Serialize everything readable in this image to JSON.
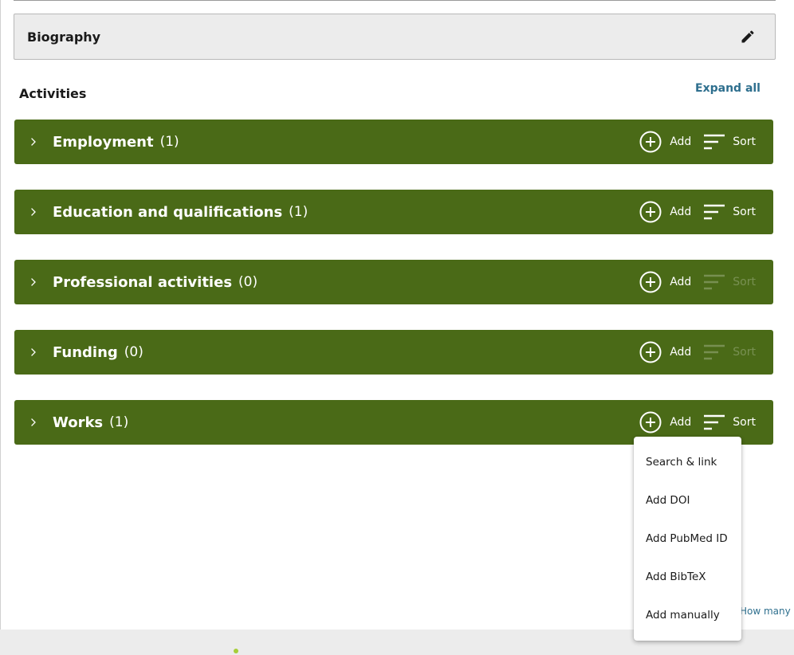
{
  "biography": {
    "title": "Biography",
    "edit_icon": "pencil-icon"
  },
  "activities": {
    "title": "Activities",
    "expand_all": "Expand all"
  },
  "sections": [
    {
      "name": "Employment",
      "count": "(1)",
      "add_label": "Add",
      "sort_label": "Sort",
      "sort_enabled": true
    },
    {
      "name": "Education and qualifications",
      "count": "(1)",
      "add_label": "Add",
      "sort_label": "Sort",
      "sort_enabled": true
    },
    {
      "name": "Professional activities",
      "count": "(0)",
      "add_label": "Add",
      "sort_label": "Sort",
      "sort_enabled": false
    },
    {
      "name": "Funding",
      "count": "(0)",
      "add_label": "Add",
      "sort_label": "Sort",
      "sort_enabled": false
    },
    {
      "name": "Works",
      "count": "(1)",
      "add_label": "Add",
      "sort_label": "Sort",
      "sort_enabled": true
    }
  ],
  "works_add_menu": {
    "items": [
      "Search & link",
      "Add DOI",
      "Add PubMed ID",
      "Add BibTeX",
      "Add manually"
    ]
  },
  "link_partial": "How many p",
  "colors": {
    "section_bg": "#4a6a17",
    "link": "#2e6f8e",
    "panel_bg": "#ececec",
    "accent_dot": "#a6ce39"
  },
  "icons": {
    "chevron": "chevron-right-icon",
    "add": "add-circle-icon",
    "sort": "sort-icon"
  }
}
